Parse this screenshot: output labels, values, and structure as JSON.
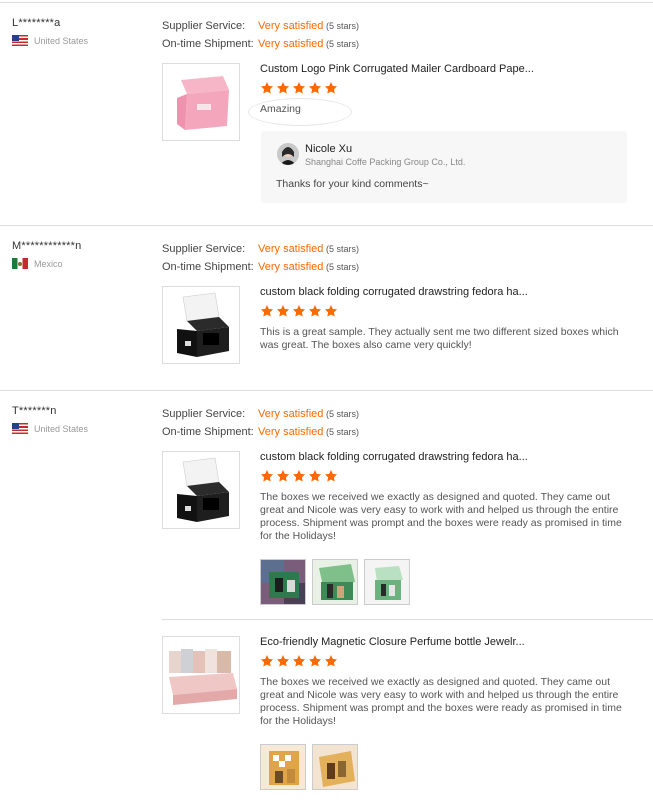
{
  "rating_labels": {
    "supplier_service": "Supplier Service:",
    "shipment": "On-time Shipment:"
  },
  "colors": {
    "accent": "#ff6a00",
    "separator": "#dddddd"
  },
  "reviews": [
    {
      "buyer": "L********a",
      "country": "United States",
      "flag": "us-flag-icon",
      "supplier_service": {
        "value": "Very satisfied",
        "stars": "(5 stars)"
      },
      "shipment": {
        "value": "Very satisfied",
        "stars": "(5 stars)"
      },
      "items": [
        {
          "title": "Custom Logo Pink Corrugated Mailer Cardboard Pape...",
          "rating": 5,
          "text": "Amazing"
        }
      ],
      "reply": {
        "name": "Nicole Xu",
        "company": "Shanghai Coffe Packing Group Co., Ltd.",
        "text": "Thanks for your kind comments~"
      }
    },
    {
      "buyer": "M************n",
      "country": "Mexico",
      "flag": "mexico-flag-icon",
      "supplier_service": {
        "value": "Very satisfied",
        "stars": "(5 stars)"
      },
      "shipment": {
        "value": "Very satisfied",
        "stars": "(5 stars)"
      },
      "items": [
        {
          "title": "custom black folding corrugated drawstring fedora ha...",
          "rating": 5,
          "text": "This is a great sample. They actually sent me two different sized boxes which was great. The boxes also came very quickly!"
        }
      ]
    },
    {
      "buyer": "T*******n",
      "country": "United States",
      "flag": "us-flag-icon",
      "supplier_service": {
        "value": "Very satisfied",
        "stars": "(5 stars)"
      },
      "shipment": {
        "value": "Very satisfied",
        "stars": "(5 stars)"
      },
      "items": [
        {
          "title": "custom black folding corrugated drawstring fedora ha...",
          "rating": 5,
          "text": "The boxes we received we exactly as designed and quoted. They came out great and Nicole was very easy to work with and helped us through the entire process. Shipment was prompt and the boxes were ready as promised in time for the Holidays!",
          "photos": 3
        },
        {
          "title": "Eco-friendly Magnetic Closure Perfume bottle Jewelr...",
          "rating": 5,
          "text": "The boxes we received we exactly as designed and quoted. They came out great and Nicole was very easy to work with and helped us through the entire process. Shipment was prompt and the boxes were ready as promised in time for the Holidays!",
          "photos": 2
        }
      ]
    }
  ]
}
